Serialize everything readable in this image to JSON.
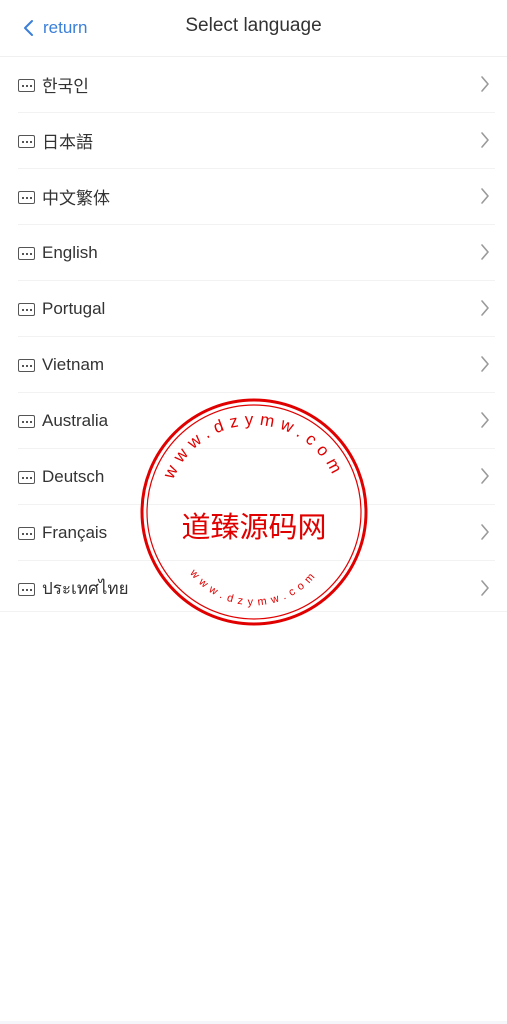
{
  "header": {
    "back_label": "return",
    "title": "Select language"
  },
  "languages": [
    {
      "label": "한국인"
    },
    {
      "label": "日本語"
    },
    {
      "label": "中文繁体"
    },
    {
      "label": "English"
    },
    {
      "label": "Portugal"
    },
    {
      "label": "Vietnam"
    },
    {
      "label": "Australia"
    },
    {
      "label": "Deutsch"
    },
    {
      "label": "Français"
    },
    {
      "label": "ประเทศไทย"
    }
  ],
  "watermark": {
    "text": "道臻源码网",
    "url_top": "www.dzymw.com",
    "url_bottom": "www.dzymw.com",
    "color": "#e00000"
  },
  "colors": {
    "accent": "#3a7fd9",
    "text": "#333333",
    "chevron": "#9a9a9a"
  }
}
